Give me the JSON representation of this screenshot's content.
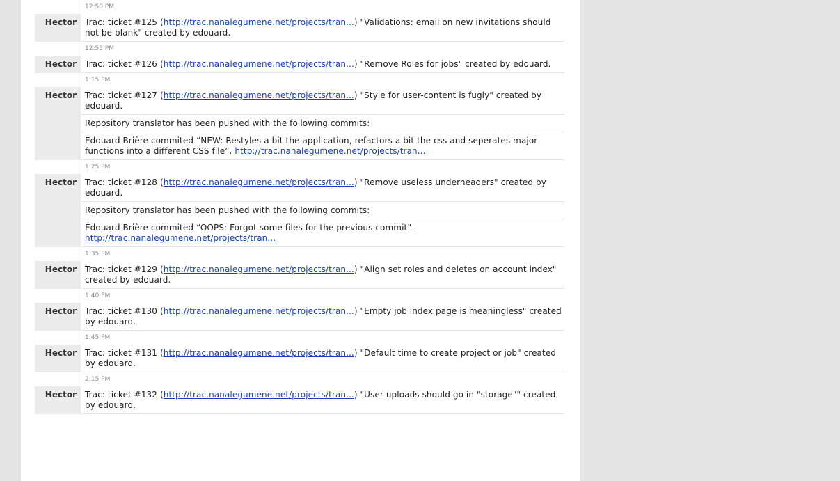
{
  "messages": [
    {
      "time": "12:50 PM",
      "author": "Hector",
      "lines": [
        {
          "pre": "Trac: ticket #125 (",
          "link": "http://trac.nanalegumene.net/projects/tran...",
          "post": ") \"Validations: email on new invitations should not be blank\" created by edouard."
        }
      ]
    },
    {
      "time": "12:55 PM",
      "author": "Hector",
      "lines": [
        {
          "pre": "Trac: ticket #126 (",
          "link": "http://trac.nanalegumene.net/projects/tran...",
          "post": ") \"Remove Roles for jobs\" created by edouard."
        }
      ]
    },
    {
      "time": "1:15 PM",
      "author": "Hector",
      "lines": [
        {
          "pre": "Trac: ticket #127 (",
          "link": "http://trac.nanalegumene.net/projects/tran...",
          "post": ") \"Style for user-content is fugly\" created by edouard."
        },
        {
          "pre": "Repository translator has been pushed with the following commits:",
          "link": "",
          "post": ""
        },
        {
          "pre": "Édouard Brière commited “NEW: Restyles a bit the application, refactors a bit the css and seperates major functions into a different CSS file”. ",
          "link": "http://trac.nanalegumene.net/projects/tran...",
          "post": ""
        }
      ]
    },
    {
      "time": "1:25 PM",
      "author": "Hector",
      "lines": [
        {
          "pre": "Trac: ticket #128 (",
          "link": "http://trac.nanalegumene.net/projects/tran...",
          "post": ") \"Remove useless underheaders\" created by edouard."
        },
        {
          "pre": "Repository translator has been pushed with the following commits:",
          "link": "",
          "post": ""
        },
        {
          "pre": "Édouard Brière commited “OOPS: Forgot some files for the previous commit”. ",
          "link": "http://trac.nanalegumene.net/projects/tran...",
          "post": ""
        }
      ]
    },
    {
      "time": "1:35 PM",
      "author": "Hector",
      "lines": [
        {
          "pre": "Trac: ticket #129 (",
          "link": "http://trac.nanalegumene.net/projects/tran...",
          "post": ") \"Align set roles and deletes on account index\" created by edouard."
        }
      ]
    },
    {
      "time": "1:40 PM",
      "author": "Hector",
      "lines": [
        {
          "pre": "Trac: ticket #130 (",
          "link": "http://trac.nanalegumene.net/projects/tran...",
          "post": ") \"Empty job index page is meaningless\" created by edouard."
        }
      ]
    },
    {
      "time": "1:45 PM",
      "author": "Hector",
      "lines": [
        {
          "pre": "Trac: ticket #131 (",
          "link": "http://trac.nanalegumene.net/projects/tran...",
          "post": ") \"Default time to create project or job\" created by edouard."
        }
      ]
    },
    {
      "time": "2:15 PM",
      "author": "Hector",
      "lines": [
        {
          "pre": "Trac: ticket #132 (",
          "link": "http://trac.nanalegumene.net/projects/tran...",
          "post": ") \"User uploads should go in \"storage\"\" created by edouard."
        }
      ]
    }
  ]
}
